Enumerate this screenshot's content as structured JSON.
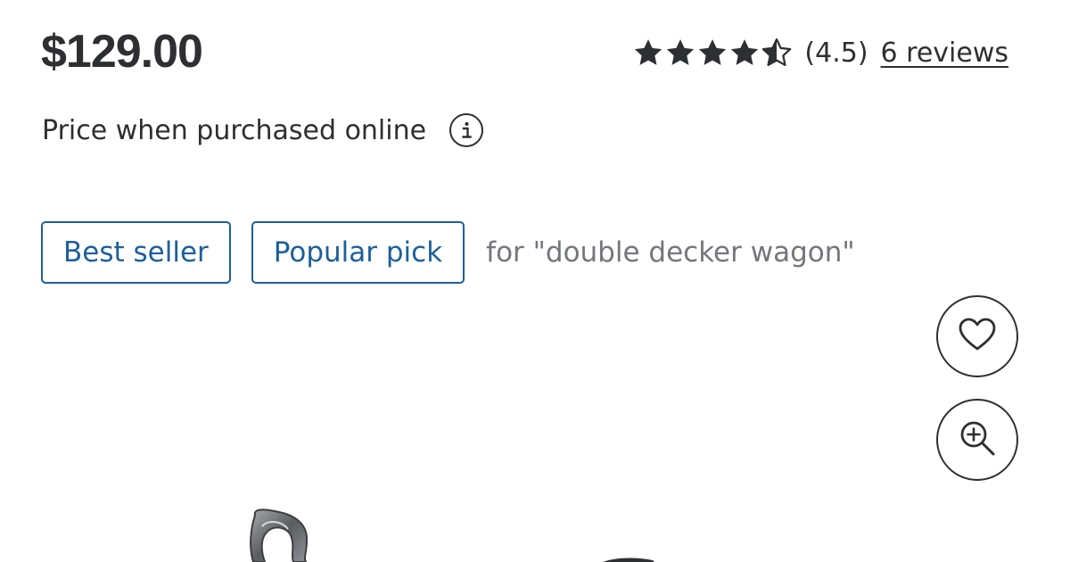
{
  "product": {
    "price": "$129.00",
    "price_note": "Price when purchased online",
    "rating": {
      "value": 4.5,
      "max": 5,
      "value_label": "(4.5)",
      "reviews_label": "6 reviews"
    },
    "badges": [
      {
        "label": "Best seller"
      },
      {
        "label": "Popular pick"
      }
    ],
    "badge_context": "for \"double decker wagon\""
  },
  "icons": {
    "info": "info-icon",
    "favorite": "heart-icon",
    "zoom": "zoom-in-icon",
    "star": "star-icon"
  },
  "colors": {
    "text": "#2e2f32",
    "badge_blue": "#1d5f9b",
    "muted": "#74767c"
  }
}
